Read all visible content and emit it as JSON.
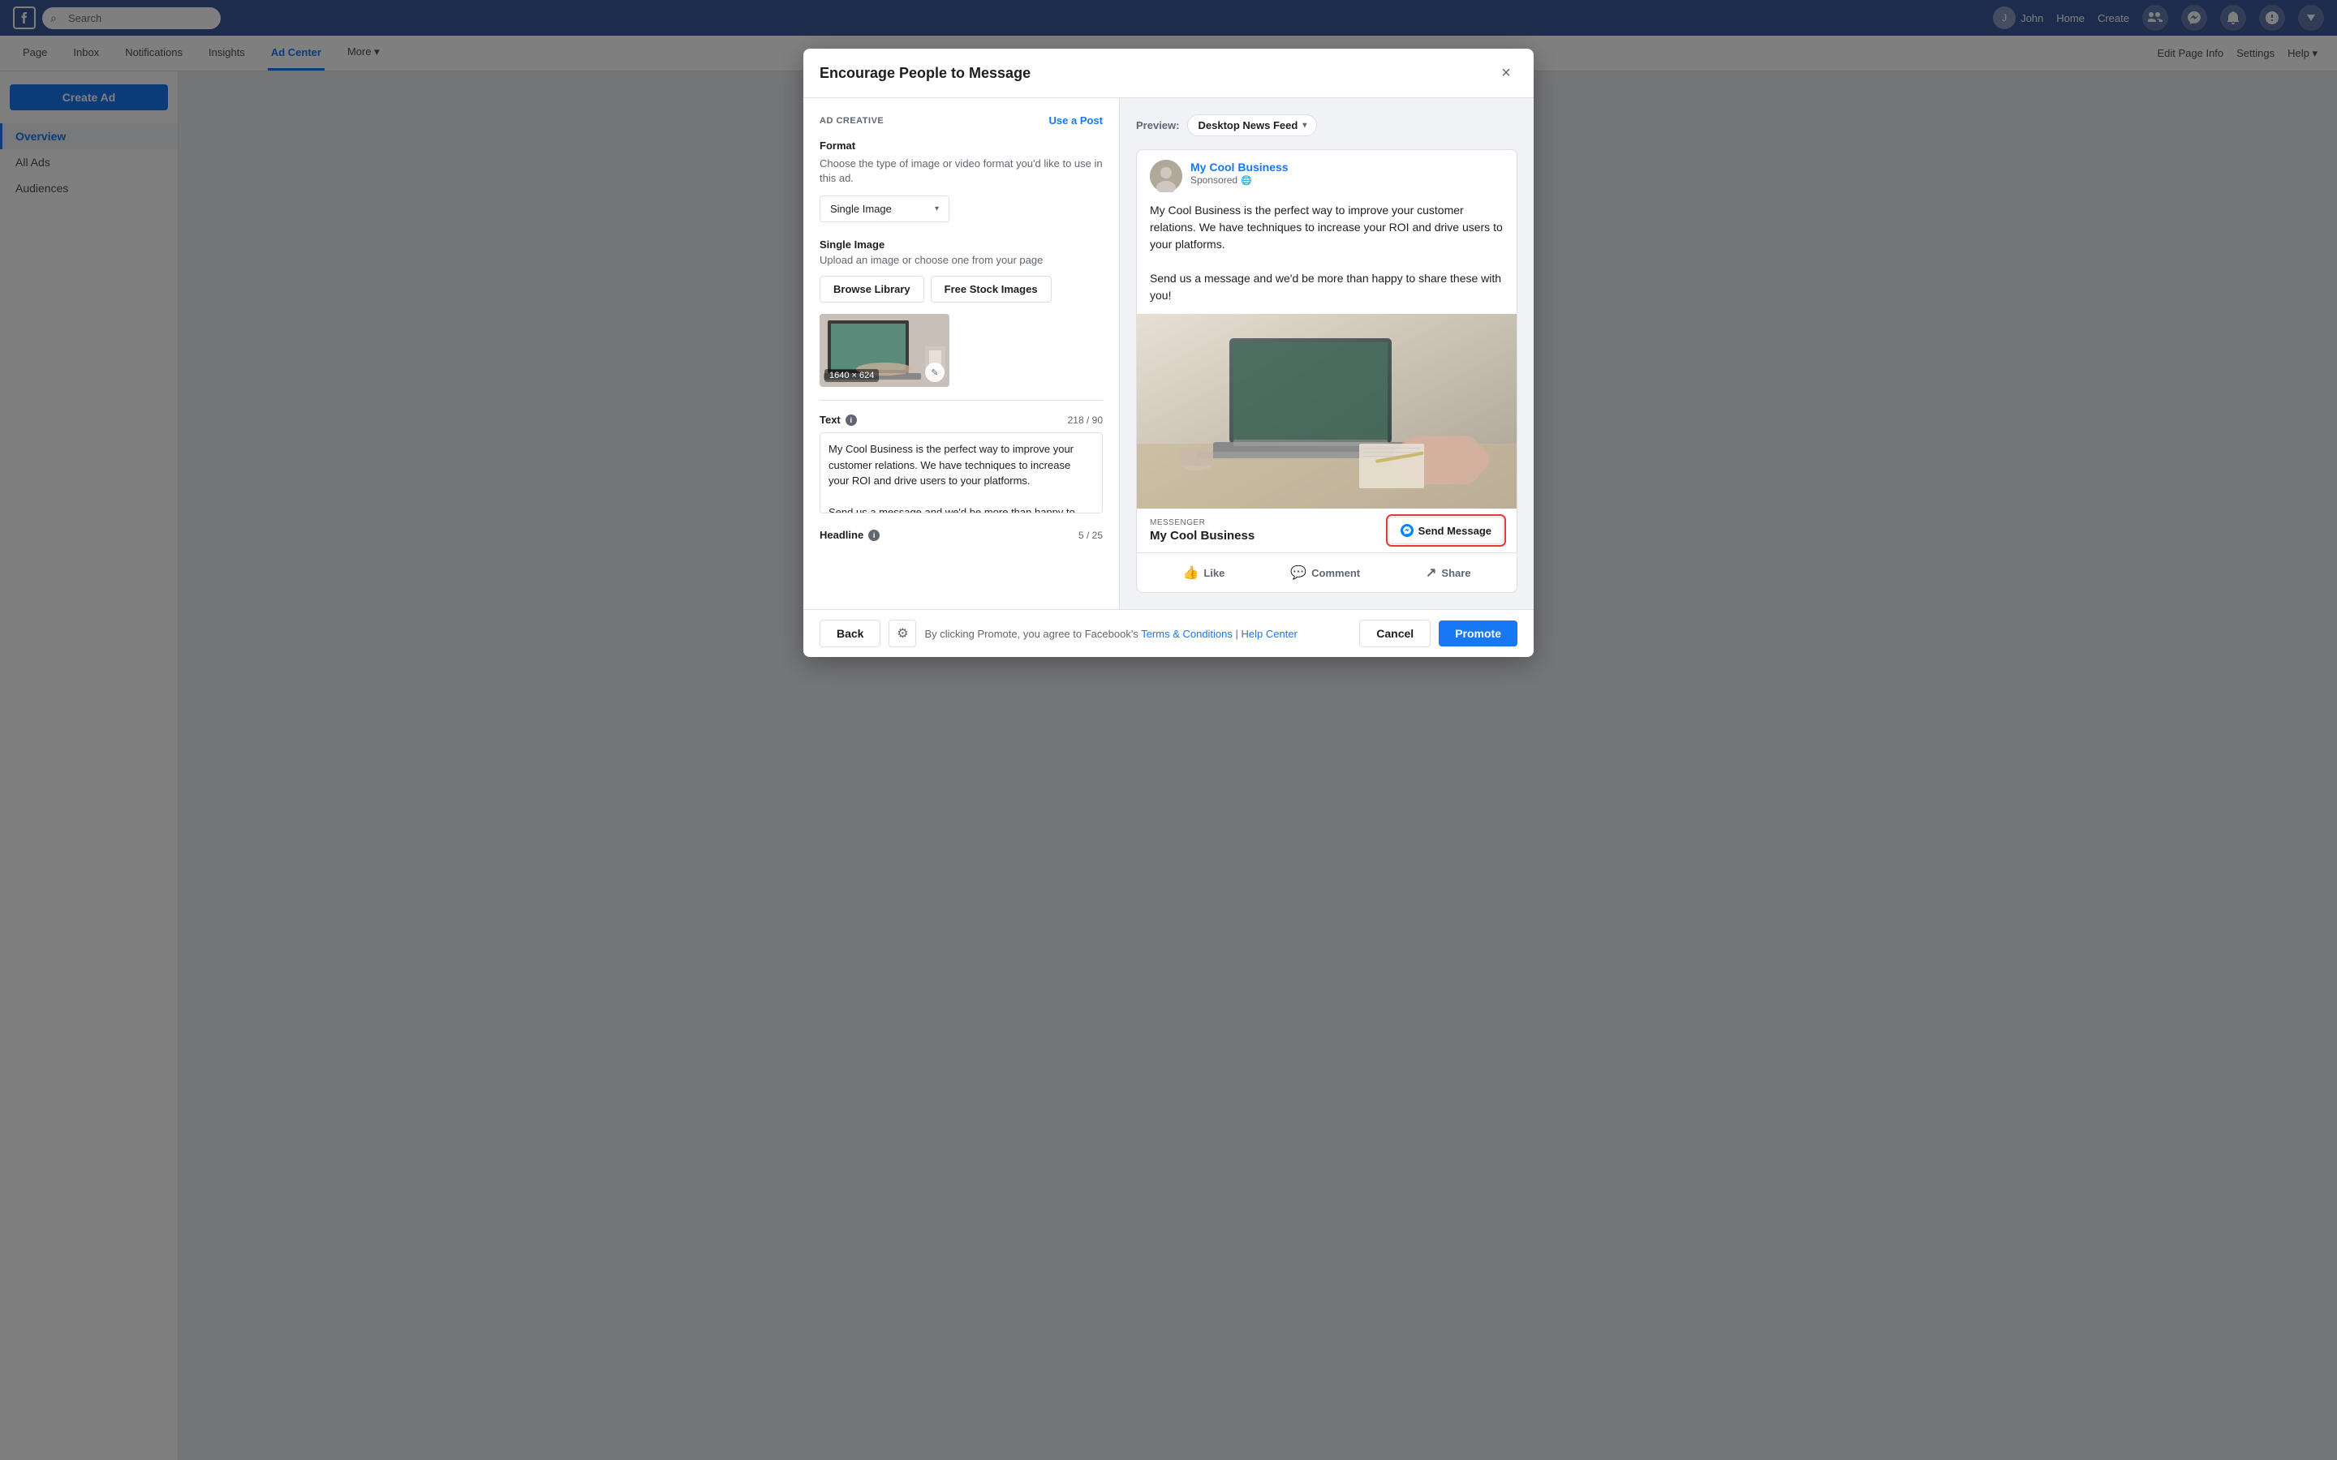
{
  "topnav": {
    "logo": "f",
    "search_placeholder": "Search",
    "user_name": "John",
    "nav_items": [
      "Home",
      "Create"
    ]
  },
  "secondnav": {
    "items": [
      "Page",
      "Inbox",
      "Notifications",
      "Insights",
      "Ad Center",
      "More ▾"
    ],
    "active": "Ad Center",
    "right_items": [
      "Edit Page Info",
      "Settings",
      "Help ▾"
    ]
  },
  "sidebar": {
    "create_btn": "Create Ad",
    "items": [
      {
        "label": "Overview",
        "active": true
      },
      {
        "label": "All Ads",
        "active": false
      },
      {
        "label": "Audiences",
        "active": false
      }
    ]
  },
  "modal": {
    "title": "Encourage People to Message",
    "close_label": "×",
    "left_panel": {
      "section_label": "AD CREATIVE",
      "use_post_label": "Use a Post",
      "format_section": {
        "label": "Format",
        "desc": "Choose the type of image or video format you'd like to use in this ad.",
        "dropdown_value": "Single Image",
        "dropdown_arrow": "▾"
      },
      "image_section": {
        "label": "Single Image",
        "desc": "Upload an image or choose one from your page",
        "browse_btn": "Browse Library",
        "stock_btn": "Free Stock Images",
        "image_dimensions": "1640 × 624",
        "edit_icon": "✎"
      },
      "text_section": {
        "label": "Text",
        "char_count": "218 / 90",
        "value": "My Cool Business is the perfect way to improve your customer relations. We have techniques to increase your ROI and drive users to your platforms.\n\nSend us a message and we'd be more than happy to share these with you!"
      },
      "headline_section": {
        "label": "Headline",
        "char_count": "5 / 25"
      }
    },
    "right_panel": {
      "preview_label": "Preview:",
      "preview_dropdown": "Desktop News Feed",
      "preview_arrow": "▾",
      "ad_card": {
        "page_name": "My Cool Business",
        "sponsored": "Sponsored",
        "globe_icon": "🌐",
        "ad_text_1": "My Cool Business is the perfect way to improve your customer relations. We have techniques to increase your ROI and drive users to your platforms.",
        "ad_text_2": "Send us a message and we'd be more than happy to share these with you!",
        "messenger_label": "MESSENGER",
        "business_name": "My Cool Business",
        "send_message_btn": "Send Message",
        "actions": {
          "like": "Like",
          "comment": "Comment",
          "share": "Share"
        }
      }
    },
    "footer": {
      "back_btn": "Back",
      "gear_icon": "⚙",
      "terms_text_before": "By clicking Promote, you agree to Facebook's ",
      "terms_link": "Terms & Conditions",
      "terms_separator": " | ",
      "help_link": "Help Center",
      "cancel_btn": "Cancel",
      "promote_btn": "Promote"
    }
  }
}
